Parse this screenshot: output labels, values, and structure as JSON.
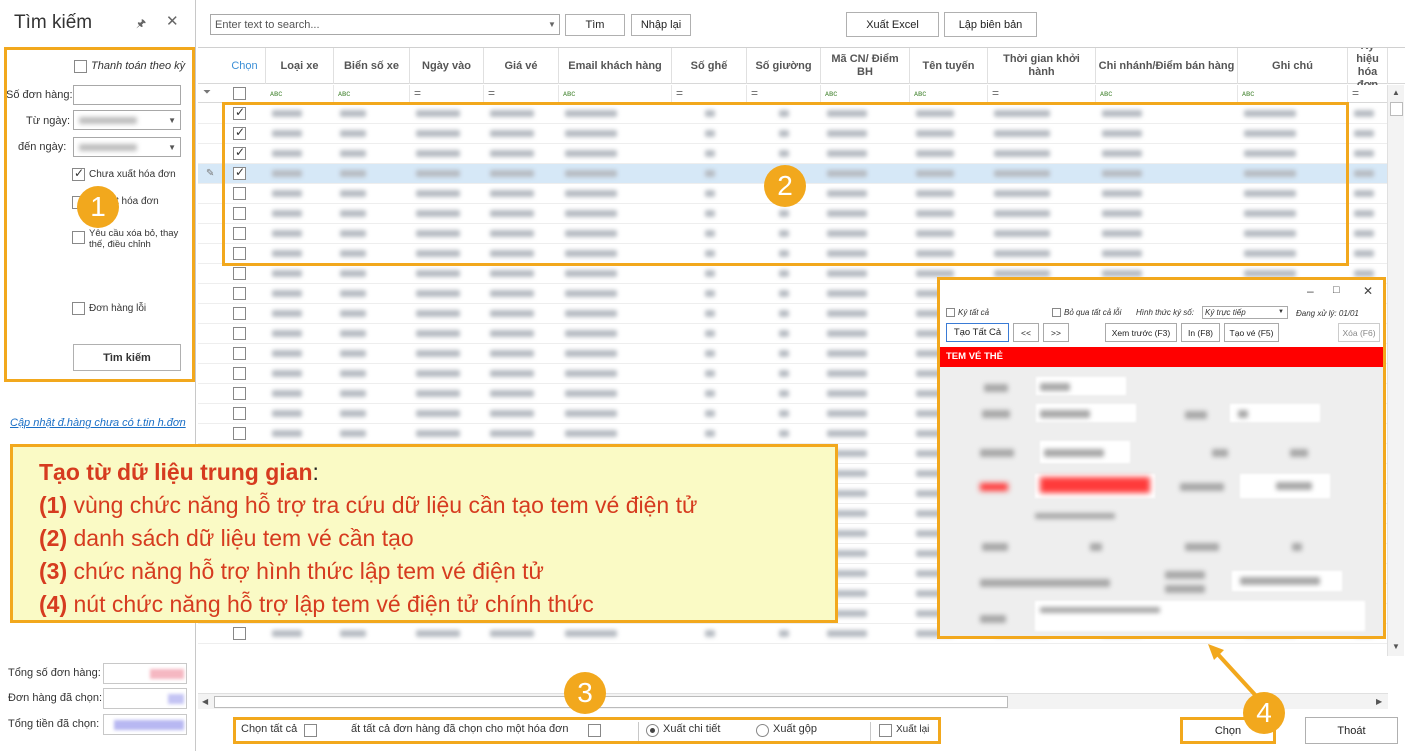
{
  "search_panel": {
    "title": "Tìm kiếm",
    "pin_icon": "pin-icon",
    "close_icon": "close-icon",
    "pay_by_period_label": "Thanh toán theo kỳ",
    "order_no_label": "Số đơn hàng:",
    "order_no_value": "",
    "from_date_label": "Từ ngày:",
    "to_date_label": "đến  ngày:",
    "cb_not_invoiced": "Chưa xuất hóa đơn",
    "cb_invoiced_partial": "t hóa đơn",
    "cb_cancel_request": "Yêu cầu xóa bỏ, thay thế, điều chỉnh",
    "cb_error_orders": "Đơn hàng lỗi",
    "search_button": "Tìm kiếm",
    "update_link": "Cập nhật đ.hàng chưa có t.tin h.đơn",
    "total_orders_label": "Tổng số đơn hàng:",
    "selected_orders_label": "Đơn hàng đã chọn:",
    "selected_total_label": "Tổng tiền đã chọn:"
  },
  "toolbar": {
    "search_placeholder": "Enter text to search...",
    "find_button": "Tìm",
    "reset_button": "Nhập lại",
    "export_excel_button": "Xuất Excel",
    "create_report_button": "Lập biên bản"
  },
  "grid": {
    "columns": [
      "Chọn",
      "Loại xe",
      "Biển số xe",
      "Ngày vào",
      "Giá vé",
      "Email khách hàng",
      "Số ghế",
      "Số giường",
      "Mã CN/ Điểm BH",
      "Tên tuyến",
      "Thời gian khởi hành",
      "Chi nhánh/Điểm bán hàng",
      "Ghi chú",
      "Ký hiệu hóa đơn"
    ],
    "filter_types": [
      "",
      "ABC",
      "ABC",
      "=",
      "=",
      "ABC",
      "=",
      "=",
      "ABC",
      "ABC",
      "=",
      "ABC",
      "ABC",
      "="
    ],
    "rows_checked": [
      true,
      true,
      true,
      true,
      false,
      false,
      false,
      false,
      false,
      false,
      false,
      false,
      false,
      false,
      false,
      false,
      false,
      false,
      false,
      false,
      false,
      false,
      false,
      false,
      false,
      false,
      false
    ],
    "selected_row_index": 3
  },
  "popup": {
    "sign_all_label": "Ký tất cả",
    "skip_all_errors_label": "Bỏ qua tất cả lỗi",
    "sign_method_label": "Hình thức ký số:",
    "sign_method_value": "Ký trực tiếp",
    "processing_label": "Đang xử lý: 01/01",
    "create_all_button": "Tạo Tất Cả",
    "prev_button": "<<",
    "next_button": ">>",
    "preview_button": "Xem trước (F3)",
    "print_button": "In (F8)",
    "create_ticket_button": "Tạo vé (F5)",
    "delete_button": "Xóa (F6)",
    "header_title": "TEM VÉ THẺ",
    "minimize_icon": "minimize-icon",
    "maximize_icon": "maximize-icon",
    "close_icon": "close-icon"
  },
  "note": {
    "title": "Tạo từ dữ liệu trung gian",
    "items": [
      {
        "num": "(1)",
        "text": "vùng chức năng hỗ trợ tra cứu dữ liệu cần tạo tem vé điện tử"
      },
      {
        "num": "(2)",
        "text": "danh sách dữ liệu tem vé cần tạo"
      },
      {
        "num": "(3)",
        "text": "chức năng hỗ trợ hình thức lập tem vé điện tử"
      },
      {
        "num": "(4)",
        "text": "nút chức năng hỗ trợ lập tem vé điện tử chính thức"
      }
    ]
  },
  "badges": [
    "1",
    "2",
    "3",
    "4"
  ],
  "bottom_bar": {
    "select_all_label": "Chọn tất cả",
    "merge_label": "ất tất cả đơn hàng đã chọn cho một hóa đơn",
    "detail_export_label": "Xuất chi tiết",
    "grouped_export_label": "Xuất gộp",
    "re_export_label": "Xuất lại",
    "choose_button": "Chọn",
    "exit_button": "Thoát"
  },
  "colors": {
    "highlight": "#f2a81d",
    "note_text": "#d63b1f",
    "note_bg": "#fafac5",
    "popup_header": "#ff0000",
    "selected_row": "#d6e8f7"
  }
}
